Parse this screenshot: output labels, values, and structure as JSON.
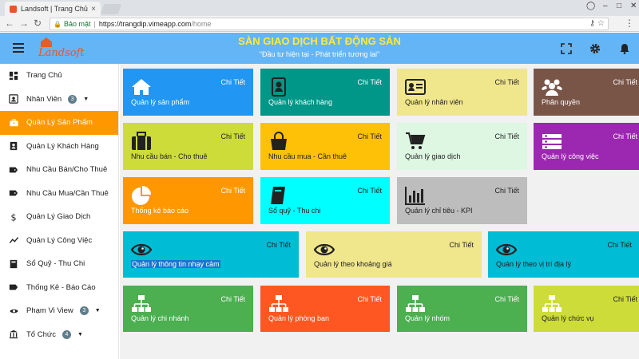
{
  "browser": {
    "tab_title": "Landsoft | Trang Chủ",
    "tab_close": "×",
    "security_label": "Bảo mật",
    "url_host": "https://trangdip.vimeapp.com",
    "url_path": "/home"
  },
  "header": {
    "logo_text": "Landsoft",
    "title": "SÀN GIAO DỊCH BẤT ĐỘNG SẢN",
    "subtitle": "\"Đầu tư hiện tại - Phát triển tương lai\""
  },
  "sidebar": {
    "items": [
      {
        "label": "Trang Chủ",
        "icon": "dashboard-icon"
      },
      {
        "label": "Nhân Viên",
        "icon": "person-badge-icon",
        "badge": "3"
      },
      {
        "label": "Quản Lý Sản Phẩm",
        "icon": "briefcase-icon",
        "active": true
      },
      {
        "label": "Quản Lý Khách Hàng",
        "icon": "contact-icon"
      },
      {
        "label": "Nhu Cầu Bán/Cho Thuê",
        "icon": "tag-icon"
      },
      {
        "label": "Nhu Cầu Mua/Cần Thuê",
        "icon": "tag-icon"
      },
      {
        "label": "Quản Lý Giao Dịch",
        "icon": "dollar-icon"
      },
      {
        "label": "Quản Lý Công Việc",
        "icon": "trend-icon"
      },
      {
        "label": "Sổ Quỹ - Thu Chi",
        "icon": "book-icon"
      },
      {
        "label": "Thống Kê - Báo Cáo",
        "icon": "report-icon"
      },
      {
        "label": "Phạm Vi View",
        "icon": "eye-icon",
        "badge": "3"
      },
      {
        "label": "Tổ Chức",
        "icon": "bank-icon",
        "badge": "4"
      }
    ]
  },
  "cards": {
    "more_label": "Chi Tiết",
    "items": [
      {
        "label": "Quản lý sản phẩm",
        "color": "#2196f3",
        "icon": "home-icon"
      },
      {
        "label": "Quản lý khách hàng",
        "color": "#009688",
        "icon": "contact-book-icon"
      },
      {
        "label": "Quản lý nhân viên",
        "color": "#f0e68c",
        "icon": "id-card-icon"
      },
      {
        "label": "Phân quyền",
        "color": "#795548",
        "icon": "group-icon"
      },
      {
        "label": "Nhu cầu bán - Cho thuê",
        "color": "#cddc39",
        "icon": "suitcase-icon"
      },
      {
        "label": "Nhu cầu mua - Cần thuê",
        "color": "#ffc107",
        "icon": "shopping-bag-icon"
      },
      {
        "label": "Quản lý giao dịch",
        "color": "#ddf7e2",
        "icon": "cart-icon"
      },
      {
        "label": "Quản lý công việc",
        "color": "#9c27b0",
        "icon": "tasks-icon"
      },
      {
        "label": "Thống kê báo cáo",
        "color": "#ff9800",
        "icon": "pie-chart-icon"
      },
      {
        "label": "Sổ quỹ - Thu chi",
        "color": "#00ffff",
        "icon": "ledger-icon"
      },
      {
        "label": "Quản lý chỉ tiêu - KPI",
        "color": "#bdbdbd",
        "icon": "bar-chart-icon"
      },
      {
        "label": "Quản lý thông tin nhạy cảm",
        "color": "#00bcd4",
        "icon": "eye-icon"
      },
      {
        "label": "Quản lý theo khoảng giá",
        "color": "#f0e68c",
        "icon": "eye-icon"
      },
      {
        "label": "Quản lý theo vị trí địa lý",
        "color": "#00bcd4",
        "icon": "eye-icon"
      },
      {
        "label": "Quản lý chi nhánh",
        "color": "#4caf50",
        "icon": "org-chart-icon"
      },
      {
        "label": "Quản lý phòng ban",
        "color": "#ff5722",
        "icon": "org-chart-icon"
      },
      {
        "label": "Quản lý nhóm",
        "color": "#4caf50",
        "icon": "org-chart-icon"
      },
      {
        "label": "Quản lý chức vụ",
        "color": "#cddc39",
        "icon": "org-chart-icon"
      }
    ]
  }
}
